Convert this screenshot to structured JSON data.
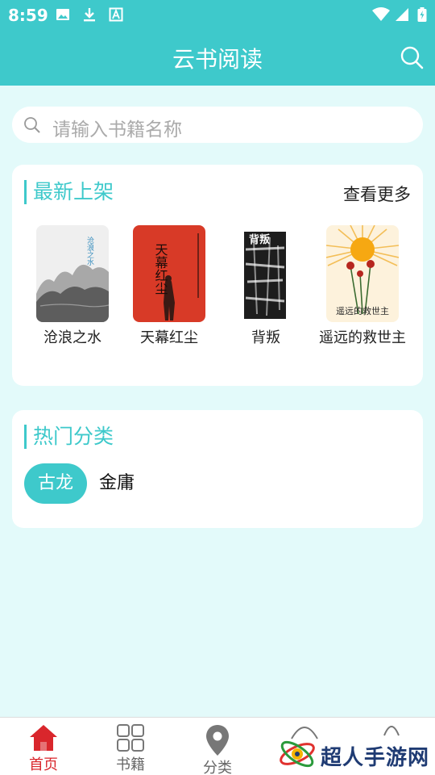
{
  "status_bar": {
    "time": "8:59",
    "left_icons": [
      "image-icon",
      "download-icon",
      "font-icon"
    ],
    "right_icons": [
      "wifi-icon",
      "signal-icon",
      "battery-icon"
    ]
  },
  "app_bar": {
    "title": "云书阅读",
    "search_icon": "search-icon"
  },
  "search": {
    "placeholder": "请输入书籍名称"
  },
  "latest": {
    "title": "最新上架",
    "more": "查看更多",
    "books": [
      {
        "name": "沧浪之水",
        "cover_title": "沧浪之水"
      },
      {
        "name": "天幕红尘",
        "cover_title": "天幕红尘"
      },
      {
        "name": "背叛",
        "cover_title": "背叛"
      },
      {
        "name": "遥远的救世主",
        "cover_title": "遥远的救世主"
      }
    ]
  },
  "hot": {
    "title": "热门分类",
    "tags": [
      {
        "label": "古龙",
        "active": true
      },
      {
        "label": "金庸",
        "active": false
      }
    ]
  },
  "bottom_nav": {
    "items": [
      {
        "label": "首页",
        "icon": "home-icon",
        "active": true
      },
      {
        "label": "书籍",
        "icon": "grid-icon",
        "active": false
      },
      {
        "label": "分类",
        "icon": "location-pin-icon",
        "active": false
      },
      {
        "label": "",
        "icon": "face-icon",
        "active": false
      },
      {
        "label": "",
        "icon": "user-icon",
        "active": false
      }
    ]
  },
  "watermark": {
    "text": "超人手游网"
  },
  "colors": {
    "accent": "#3ec9cb",
    "page_bg": "#e3fafa",
    "nav_active": "#d9262c"
  }
}
